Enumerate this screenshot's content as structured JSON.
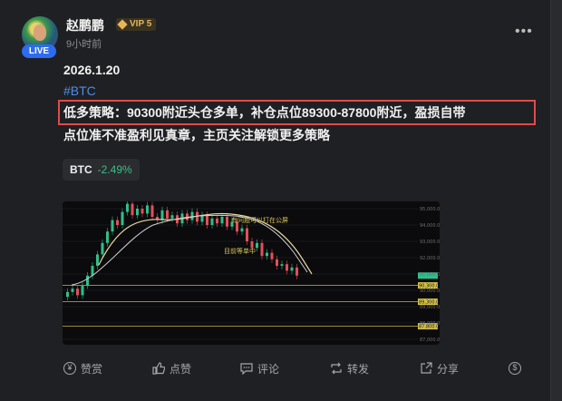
{
  "post": {
    "username": "赵鹏鹏",
    "vip_label": "VIP 5",
    "time_ago": "9小时前",
    "live_badge": "LIVE",
    "date_line": "2026.1.20",
    "hashtag": "#BTC",
    "text_line1": "低多策略：90300附近头仓多单，补仓点位89300-87800附近，盈损自带",
    "text_line2": "点位准不准盈利见真章，主页关注解锁更多策略"
  },
  "ticker": {
    "symbol": "BTC",
    "change": "-2.49%"
  },
  "chart_image": {
    "annotation_1": "有问题可以打在公屏",
    "annotation_2": "目前等单中",
    "price_axis": [
      "95,000.0",
      "94,000.0",
      "93,000.0",
      "92,000.0",
      "91,000.0",
      "90,000.0",
      "89,000.0",
      "88,000.0",
      "87,000.0"
    ],
    "level_labels": [
      "90,300.0",
      "89,300.0",
      "87,800.0"
    ]
  },
  "actions": {
    "reward": "赞赏",
    "like": "点赞",
    "comment": "评论",
    "repost": "转发",
    "share": "分享"
  },
  "colors": {
    "up": "#2fbf8a",
    "down": "#e0505a",
    "accent": "#4c8eea",
    "highlight_border": "#e04a4a"
  }
}
